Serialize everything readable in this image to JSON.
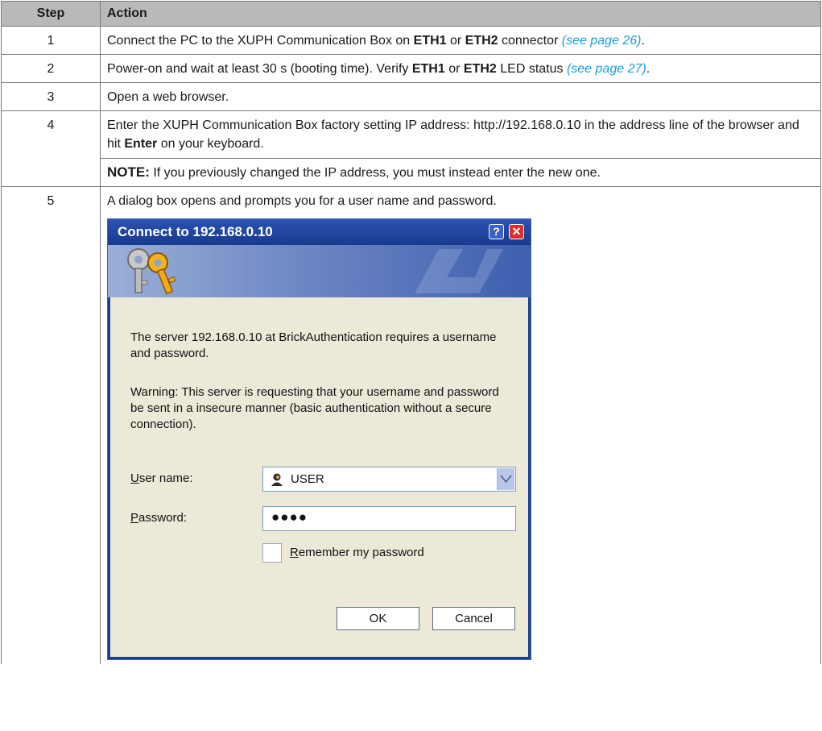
{
  "table": {
    "headers": {
      "step": "Step",
      "action": "Action"
    },
    "rows": [
      {
        "step": "1",
        "t1": "Connect the PC to the XUPH Communication Box on ",
        "b1": "ETH1",
        "t2": " or ",
        "b2": "ETH2",
        "t3": " connector ",
        "link": "(see page 26)",
        "t4": "."
      },
      {
        "step": "2",
        "t1": "Power-on and wait at least 30 s (booting time). Verify ",
        "b1": "ETH1",
        "t2": " or ",
        "b2": "ETH2",
        "t3": " LED status ",
        "link": "(see page 27)",
        "t4": "."
      },
      {
        "step": "3",
        "text": "Open a web browser."
      },
      {
        "step": "4",
        "t1": "Enter the XUPH Communication Box factory setting IP address: http://192.168.0.10 in the address line of the browser and hit ",
        "b1": "Enter",
        "t2": " on your keyboard.",
        "note_label": "NOTE:",
        "note_text": " If you previously changed the IP address, you must instead enter the new one."
      },
      {
        "step": "5",
        "text": "A dialog box opens and prompts you for a user name and password."
      }
    ]
  },
  "dialog": {
    "title": "Connect to 192.168.0.10",
    "help_symbol": "?",
    "close_symbol": "✕",
    "message": "The server 192.168.0.10 at BrickAuthentication requires a username and password.",
    "warning": "Warning: This server is requesting that your username and password be sent in a insecure manner (basic authentication without a secure connection).",
    "username_label_key": "U",
    "username_label_rest": "ser name:",
    "username_value": "USER",
    "password_label_key": "P",
    "password_label_rest": "assword:",
    "password_value": "●●●●",
    "remember_key": "R",
    "remember_rest": "emember my password",
    "ok_label": "OK",
    "cancel_label": "Cancel"
  }
}
